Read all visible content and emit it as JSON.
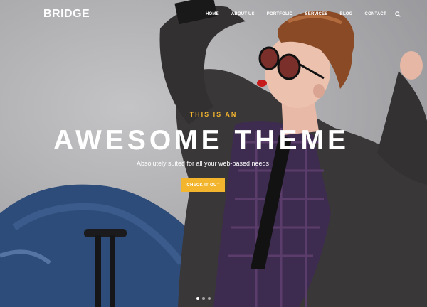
{
  "header": {
    "logo": "BRIDGE",
    "nav": [
      {
        "label": "HOME"
      },
      {
        "label": "ABOUT US"
      },
      {
        "label": "PORTFOLIO"
      },
      {
        "label": "SERVICES"
      },
      {
        "label": "BLOG"
      },
      {
        "label": "CONTACT"
      }
    ],
    "search_icon": "search-icon"
  },
  "hero": {
    "kicker": "THIS IS AN",
    "headline": "AWESOME THEME",
    "subline": "Absolutely suited for all your web-based needs",
    "cta_label": "CHECK IT OUT",
    "slider_dots": 3,
    "active_dot": 1
  },
  "colors": {
    "accent": "#f2b52d",
    "text": "#ffffff",
    "background": "#a7a7aa"
  }
}
